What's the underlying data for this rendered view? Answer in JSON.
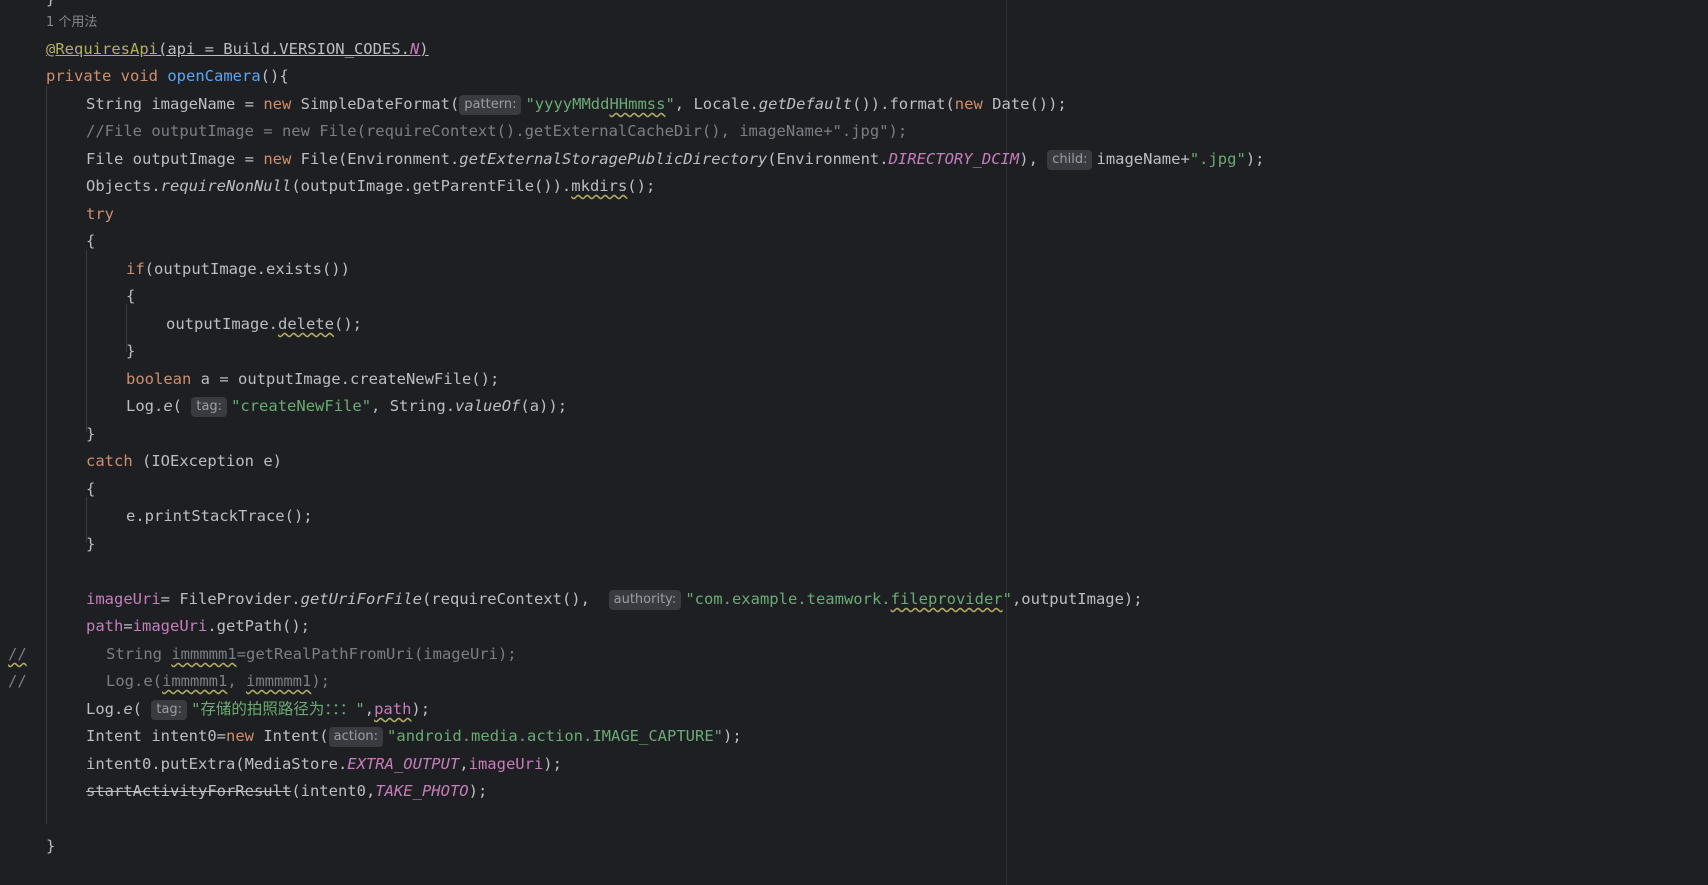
{
  "editor": {
    "usage_hint": "1 个用法",
    "tokens": {
      "annotation": "@RequiresApi",
      "annotation_args_a": "(api = Build.VERSION_CODES.",
      "annotation_n": "N",
      "annotation_close": ")",
      "private": "private",
      "void": "void",
      "method_name": "openCamera",
      "method_open": "(){",
      "string_type": "String imageName = ",
      "new": "new",
      "sdf_call": " SimpleDateFormat(",
      "hint_pattern": "pattern:",
      "pattern_str_a": "\"yyyyMMdd",
      "pattern_str_b": "HHmmss",
      "pattern_str_c": "\"",
      "locale_part": ", Locale.",
      "get_default": "getDefault",
      "format_part": "()).format(",
      "date_part": " Date());",
      "comment_line": "//File outputImage = new File(requireContext().getExternalCacheDir(), imageName+\".jpg\");",
      "file_decl": "File outputImage = ",
      "file_call": " File(Environment.",
      "get_ext": "getExternalStoragePublicDirectory",
      "env_part": "(Environment.",
      "dir_dcim": "DIRECTORY_DCIM",
      "paren_comma": "), ",
      "hint_child": "child:",
      "image_name_plus": "imageName+",
      "jpg_str": "\".jpg\"",
      "end_paren_semi": ");",
      "objects_part": "Objects.",
      "require_non_null": "requireNonNull",
      "parent_part": "(outputImage.getParentFile()).",
      "mkdirs": "mkdirs",
      "call_end": "();",
      "try": "try",
      "open_brace": "{",
      "close_brace": "}",
      "if": "if",
      "if_cond": "(outputImage.exists())",
      "delete_prefix": "outputImage.",
      "delete": "delete",
      "boolean": "boolean",
      "create_new_file_stmt": " a = outputImage.createNewFile();",
      "log_prefix": "Log.",
      "log_e": "e",
      "open_paren": "(",
      "hint_tag": "tag:",
      "create_new_file_str": "\"createNewFile\"",
      "string_value_of_a": ", String.",
      "value_of": "valueOf",
      "value_of_args": "(a));",
      "catch": "catch",
      "catch_args": " (IOException e)",
      "print_stack": "e.printStackTrace();",
      "image_uri": "imageUri",
      "file_provider_assign": "= FileProvider.",
      "get_uri_for_file": "getUriForFile",
      "require_context": "(requireContext(), ",
      "hint_authority": "authority:",
      "authority_str_a": "\"com.example.teamwork.",
      "authority_str_b": "fileprovider",
      "authority_str_c": "\"",
      "output_image_end": ",outputImage);",
      "path": "path",
      "path_assign_a": "=",
      "path_assign_b": ".getPath();",
      "comment_slashes": "//",
      "commented_1a": "String ",
      "commented_1b": "immmmm1",
      "commented_1c": "=getRealPathFromUri(imageUri);",
      "commented_2a": "Log.e(",
      "commented_2b": "immmmm1",
      "commented_2c": ", ",
      "commented_2d": "immmmm1",
      "commented_2e": ");",
      "path_str": "\"存储的拍照路径为：：：\"",
      "comma": ",",
      "intent_decl": "Intent intent0=",
      "intent_call": " Intent(",
      "hint_action": "action:",
      "action_str": "\"android.media.action.IMAGE_CAPTURE\"",
      "put_extra": "intent0.putExtra(MediaStore.",
      "extra_output": "EXTRA_OUTPUT",
      "start_activity": "startActivityForResult",
      "start_args_a": "(intent0,",
      "take_photo": "TAKE_PHOTO",
      "brace_close_method": "}"
    }
  }
}
